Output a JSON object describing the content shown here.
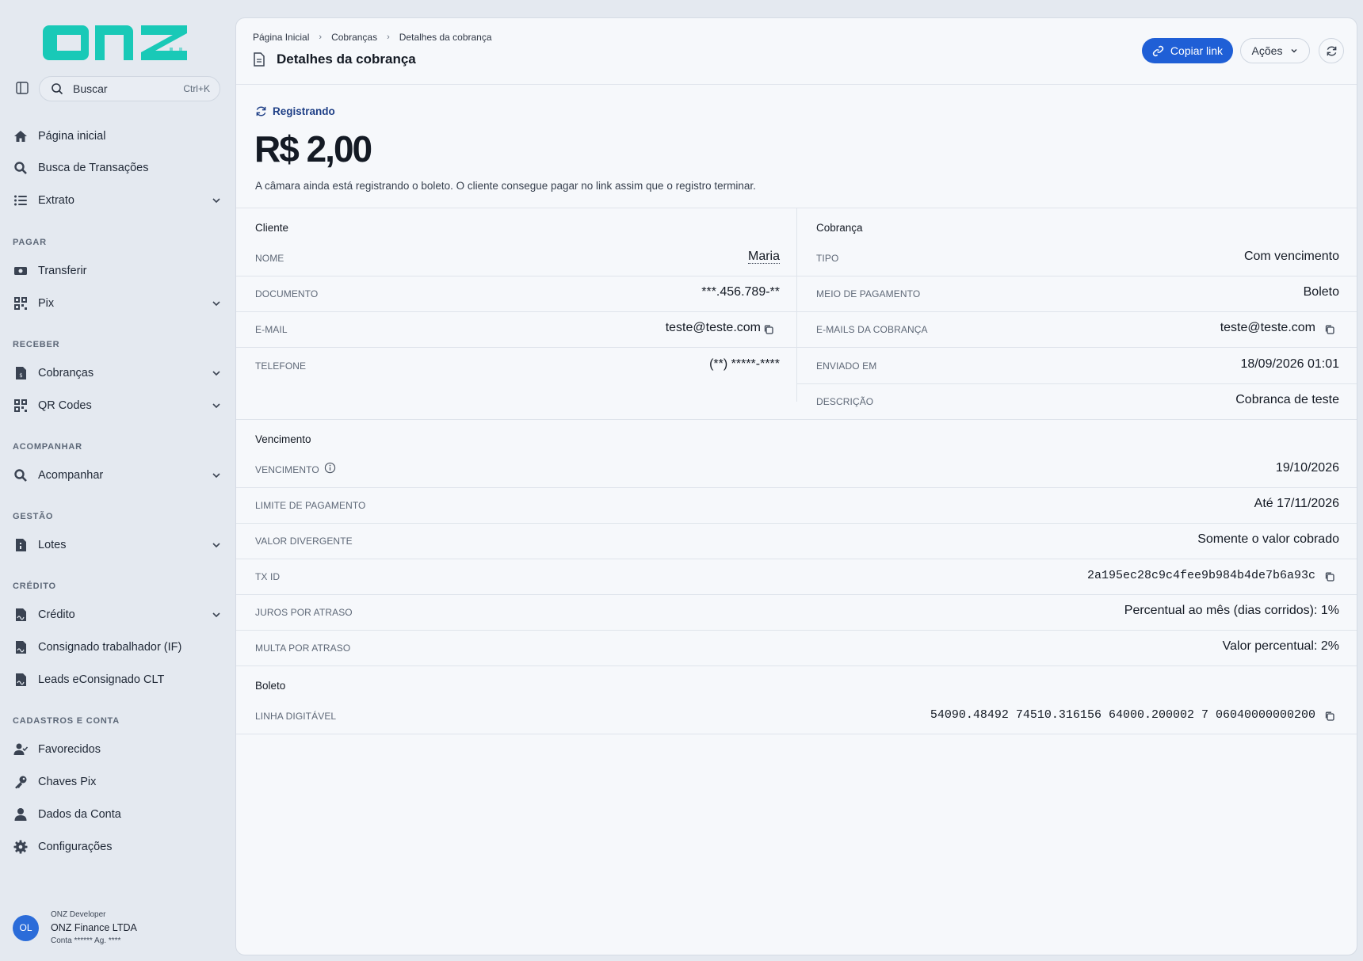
{
  "sidebar": {
    "logo_text": "ONZ",
    "search": {
      "label": "Buscar",
      "shortcut": "Ctrl+K"
    },
    "items_top": [
      {
        "label": "Página inicial",
        "icon": "home-icon"
      },
      {
        "label": "Busca de Transações",
        "icon": "search-icon"
      },
      {
        "label": "Extrato",
        "icon": "list-icon"
      }
    ],
    "sections": {
      "pagar": "PAGAR",
      "receber": "RECEBER",
      "acompanhar": "ACOMPANHAR",
      "gestao": "GESTÃO",
      "credito": "CRÉDITO",
      "cadastros": "CADASTROS E CONTA"
    },
    "items": {
      "transferir": "Transferir",
      "pix": "Pix",
      "cobrancas": "Cobranças",
      "qrcodes": "QR Codes",
      "acompanhar": "Acompanhar",
      "lotes": "Lotes",
      "credito": "Crédito",
      "consignado": "Consignado trabalhador (IF)",
      "leads": "Leads eConsignado CLT",
      "favorecidos": "Favorecidos",
      "chaves": "Chaves Pix",
      "dados": "Dados da Conta",
      "config": "Configurações"
    },
    "account": {
      "initials": "OL",
      "user": "ONZ Developer",
      "company": "ONZ Finance LTDA",
      "account": "Conta ****** Ag. ****"
    }
  },
  "header": {
    "breadcrumb": [
      "Página Inicial",
      "Cobranças",
      "Detalhes da cobrança"
    ],
    "title": "Detalhes da cobrança",
    "copy_link": "Copiar link",
    "actions": "Ações"
  },
  "summary": {
    "status": "Registrando",
    "amount": "R$ 2,00",
    "note": "A câmara ainda está registrando o boleto. O cliente consegue pagar no link assim que o registro terminar."
  },
  "cliente": {
    "title": "Cliente",
    "rows": [
      {
        "label": "NOME",
        "value": "Maria"
      },
      {
        "label": "DOCUMENTO",
        "value": "***.456.789-**"
      },
      {
        "label": "E-MAIL",
        "value": "teste@teste.com"
      },
      {
        "label": "TELEFONE",
        "value": "(**) *****-****"
      }
    ]
  },
  "cobranca": {
    "title": "Cobrança",
    "rows": [
      {
        "label": "TIPO",
        "value": "Com vencimento"
      },
      {
        "label": "MEIO DE PAGAMENTO",
        "value": "Boleto"
      },
      {
        "label": "E-MAILS DA COBRANÇA",
        "value": "teste@teste.com"
      },
      {
        "label": "ENVIADO EM",
        "value": "18/09/2026 01:01"
      },
      {
        "label": "DESCRIÇÃO",
        "value": "Cobranca de teste"
      }
    ]
  },
  "vencimento": {
    "title": "Vencimento",
    "rows": [
      {
        "label": "VENCIMENTO",
        "value": "19/10/2026"
      },
      {
        "label": "LIMITE DE PAGAMENTO",
        "value": "Até 17/11/2026"
      },
      {
        "label": "VALOR DIVERGENTE",
        "value": "Somente o valor cobrado"
      },
      {
        "label": "TX ID",
        "value": "2a195ec28c9c4fee9b984b4de7b6a93c"
      },
      {
        "label": "JUROS POR ATRASO",
        "value": "Percentual ao mês (dias corridos): 1%"
      },
      {
        "label": "MULTA POR ATRASO",
        "value": "Valor percentual: 2%"
      }
    ]
  },
  "boleto": {
    "title": "Boleto",
    "rows": [
      {
        "label": "LINHA DIGITÁVEL",
        "value": "54090.48492 74510.316156 64000.200002 7 06040000000200"
      }
    ]
  },
  "colors": {
    "accent": "#1f5fd6",
    "logo": "#19c9b7",
    "status": "#1e3f86",
    "avatar": "#2b6cd9"
  }
}
